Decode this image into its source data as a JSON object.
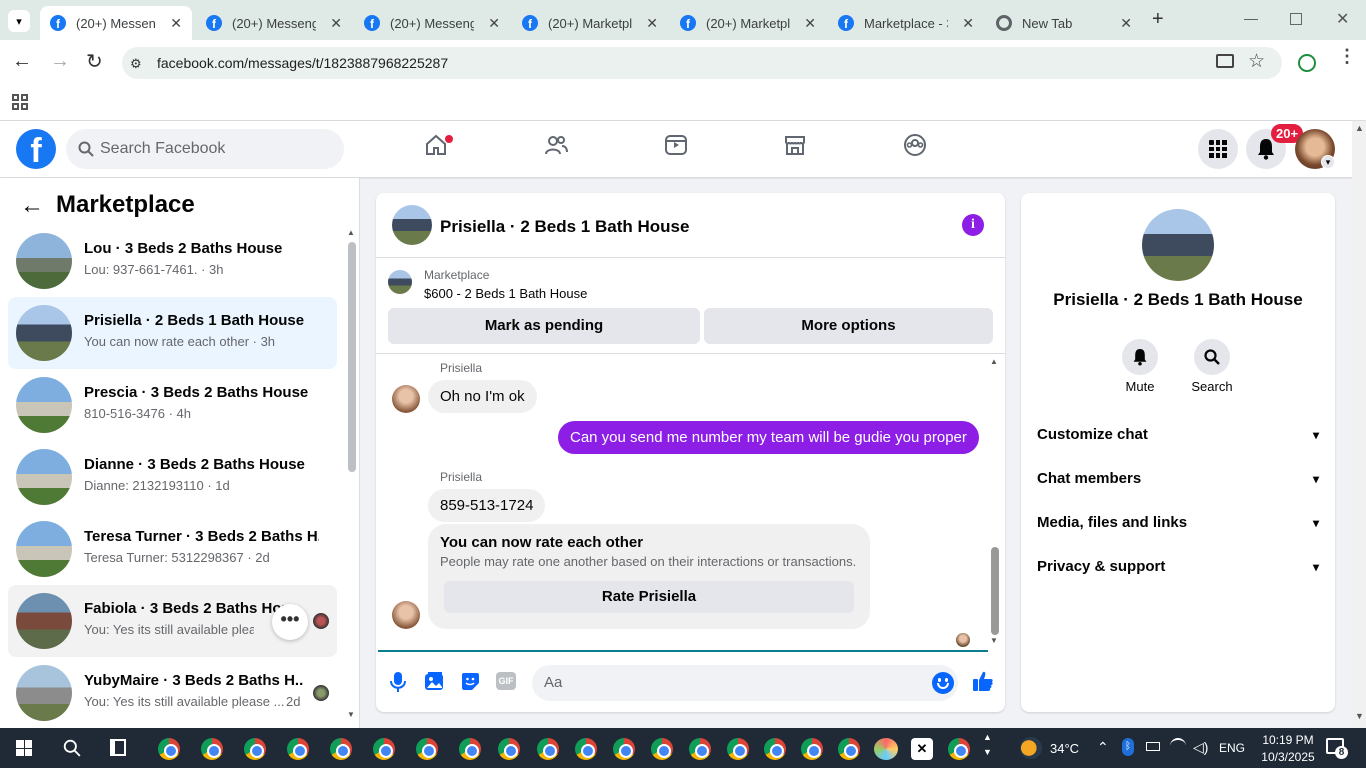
{
  "browser": {
    "tabs": [
      {
        "title": "(20+) Messenger",
        "active": true
      },
      {
        "title": "(20+) Messenger",
        "active": false
      },
      {
        "title": "(20+) Messenger",
        "active": false
      },
      {
        "title": "(20+) Marketplace",
        "active": false
      },
      {
        "title": "(20+) Marketplace",
        "active": false
      },
      {
        "title": "Marketplace - 3",
        "active": false
      },
      {
        "title": "New Tab",
        "active": false
      }
    ],
    "url": "facebook.com/messages/t/1823887968225287"
  },
  "fb": {
    "search_placeholder": "Search Facebook",
    "notif_badge": "20+"
  },
  "sidebar": {
    "title": "Marketplace",
    "conversations": [
      {
        "title": "Lou · 3 Beds 2 Baths House",
        "subtitle": "Lou: 937-661-7461. · 3h"
      },
      {
        "title": "Prisiella · 2 Beds 1 Bath House",
        "subtitle": "You can now rate each other · 3h"
      },
      {
        "title": "Prescia · 3 Beds 2 Baths House",
        "subtitle": "810-516-3476 · 4h"
      },
      {
        "title": "Dianne · 3 Beds 2 Baths House",
        "subtitle": "Dianne: 2132193110 · 1d"
      },
      {
        "title": "Teresa Turner · 3 Beds 2 Baths H...",
        "subtitle": "Teresa Turner: 5312298367 · 2d"
      },
      {
        "title": "Fabiola · 3 Beds 2 Baths Hous",
        "subtitle": "You: Yes its still available please ..."
      },
      {
        "title": "YubyMaire · 3 Beds 2 Baths H...",
        "subtitle": "You: Yes its still available please ...",
        "time": "2d"
      }
    ]
  },
  "chat": {
    "title": "Prisiella · 2 Beds 1 Bath House",
    "listing_source": "Marketplace",
    "listing_price": "$600 - 2 Beds 1 Bath House",
    "mark_pending": "Mark as pending",
    "more_options": "More options",
    "messages": {
      "sender1": "Prisiella",
      "m1": "Oh no I'm ok",
      "m2": "Can you send me number my team will be gudie you proper",
      "sender2": "Prisiella",
      "m3": "859-513-1724"
    },
    "rate": {
      "title": "You can now rate each other",
      "desc": "People may rate one another based on their interactions or transactions.",
      "button": "Rate Prisiella"
    },
    "composer_placeholder": "Aa"
  },
  "details": {
    "title": "Prisiella · 2 Beds 1 Bath House",
    "mute": "Mute",
    "search": "Search",
    "sections": [
      "Customize chat",
      "Chat members",
      "Media, files and links",
      "Privacy & support"
    ]
  },
  "taskbar": {
    "temp": "34°C",
    "lang": "ENG",
    "time": "10:19 PM",
    "date": "10/3/2025",
    "notif_count": "8"
  },
  "colors": {
    "fb_blue": "#1877f2",
    "accent_purple": "#8d1ee6",
    "selected_bg": "#ebf5ff"
  }
}
